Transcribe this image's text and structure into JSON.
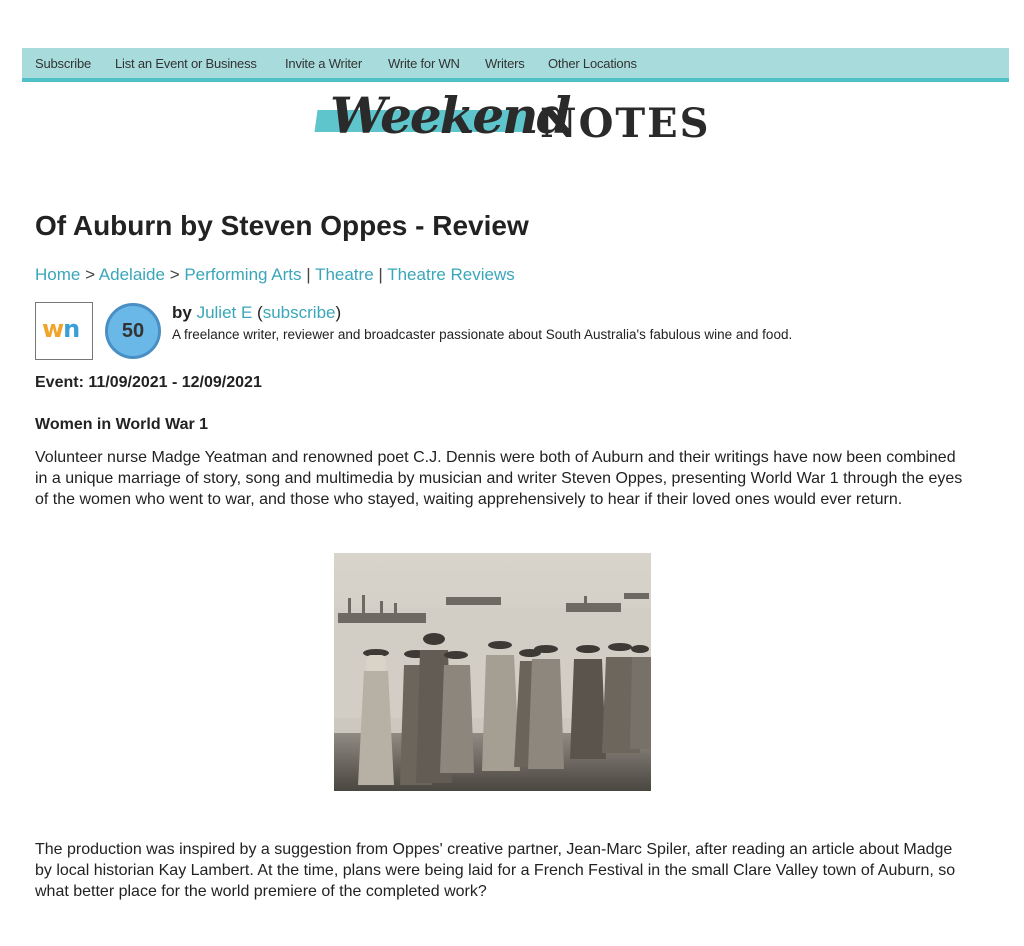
{
  "nav": {
    "items": [
      "Subscribe",
      "List an Event or Business",
      "Invite a Writer",
      "Write for WN",
      "Writers",
      "Other Locations"
    ]
  },
  "logo": {
    "word1": "Weekend",
    "word2": "NOTES",
    "accent": "#5fc5cc"
  },
  "article": {
    "title": "Of Auburn by Steven Oppes - Review",
    "breadcrumb": {
      "home": "Home",
      "sep1": " > ",
      "adelaide": "Adelaide",
      "sep2": " > ",
      "performing_arts": "Performing Arts",
      "sep3": " | ",
      "theatre": "Theatre",
      "sep4": " | ",
      "theatre_reviews": "Theatre Reviews"
    },
    "author": {
      "by": "by",
      "name": "Juliet E",
      "open_paren": " (",
      "subscribe": "subscribe",
      "close_paren": ")",
      "bio": "A freelance writer, reviewer and broadcaster passionate about South Australia's fabulous wine and food.",
      "avatar_w": "w",
      "avatar_n": "n",
      "badge": "50"
    },
    "event": "Event: 11/09/2021 - 12/09/2021",
    "subheading": "Women in World War 1",
    "paragraph1": "Volunteer nurse Madge Yeatman and renowned poet C.J. Dennis were both of Auburn and their writings have now been combined in a unique marriage of story, song and multimedia by musician and writer Steven Oppes, presenting World War 1 through the eyes of the women who went to war, and those who stayed, waiting apprehensively to hear if their loved ones would ever return.",
    "paragraph2": "The production was inspired by a suggestion from Oppes' creative partner, Jean-Marc Spiler, after reading an article about Madge by local historian Kay Lambert. At the time, plans were being laid for a French Festival in the small Clare Valley town of Auburn, so what better place for the world premiere of the completed work?"
  },
  "colors": {
    "nav_bg": "#a8dcdc",
    "nav_border": "#4fc0c6",
    "link": "#3aa6b9",
    "badge": "#6ab8e8"
  }
}
